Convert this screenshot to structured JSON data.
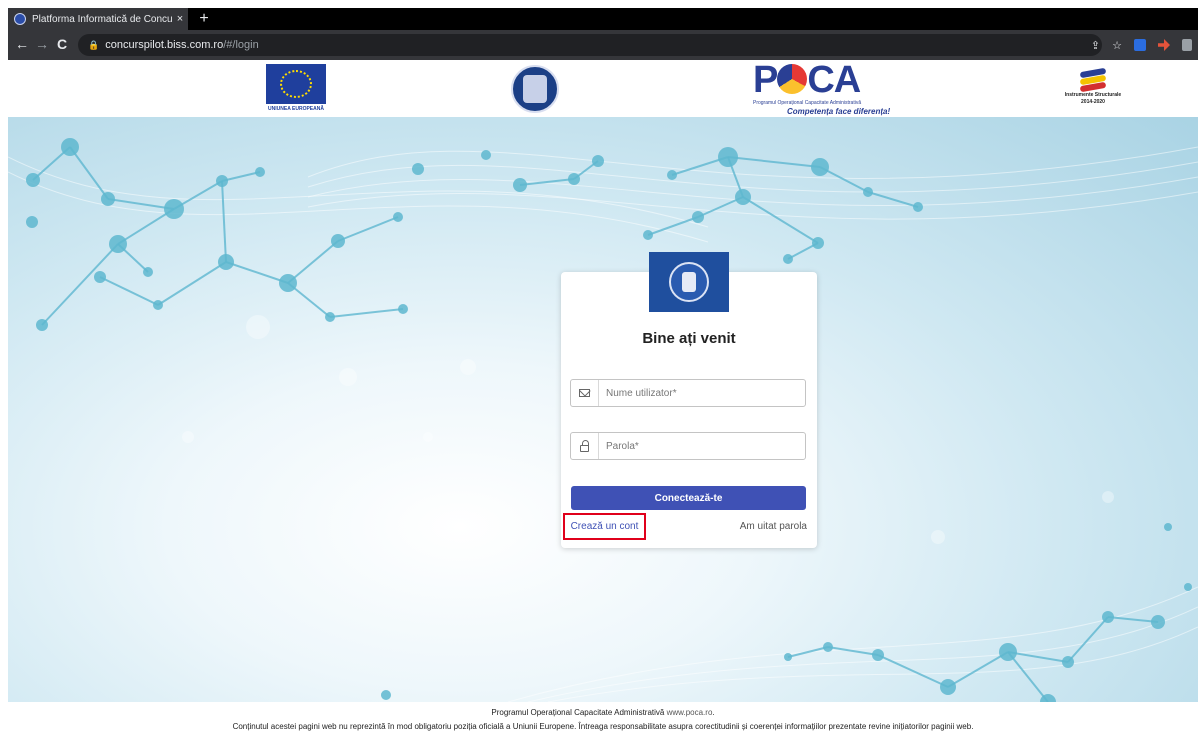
{
  "browser": {
    "tab_title": "Platforma Informatică de Concur",
    "tab_close": "×",
    "new_tab": "+",
    "url_host": "concurspilot.biss.com.ro",
    "url_path": "/#/login",
    "back_icon": "←",
    "forward_icon": "→",
    "reload_icon": "C",
    "lock_icon": "🔒",
    "share_icon": "⇪",
    "star_icon": "☆"
  },
  "header_logos": {
    "eu_label": "UNIUNEA EUROPEANĂ",
    "poca_word_start": "P",
    "poca_word_end": "CA",
    "poca_subtitle": "Programul Operațional Capacitate Administrativă",
    "poca_tagline": "Competența face diferența!",
    "is_label_1": "Instrumente Structurale",
    "is_label_2": "2014-2020"
  },
  "login": {
    "title": "Bine ați venit",
    "username_placeholder": "Nume utilizator*",
    "password_placeholder": "Parola*",
    "submit_label": "Conectează-te",
    "create_account_label": "Crează un cont",
    "forgot_password_label": "Am uitat parola"
  },
  "footer": {
    "line1_text": "Programul Operațional Capacitate Administrativă",
    "line1_link": "www.poca.ro",
    "line1_end": ".",
    "line2": "Conținutul acestei pagini web nu reprezintă în mod obligatoriu poziția oficială a Uniunii Europene. Întreaga responsabilitate asupra corectitudinii și coerenței informațiilor prezentate revine inițiatorilor paginii web."
  },
  "colors": {
    "primary": "#3f51b5",
    "highlight_border": "#e0001b",
    "browser_dark": "#35363a"
  }
}
